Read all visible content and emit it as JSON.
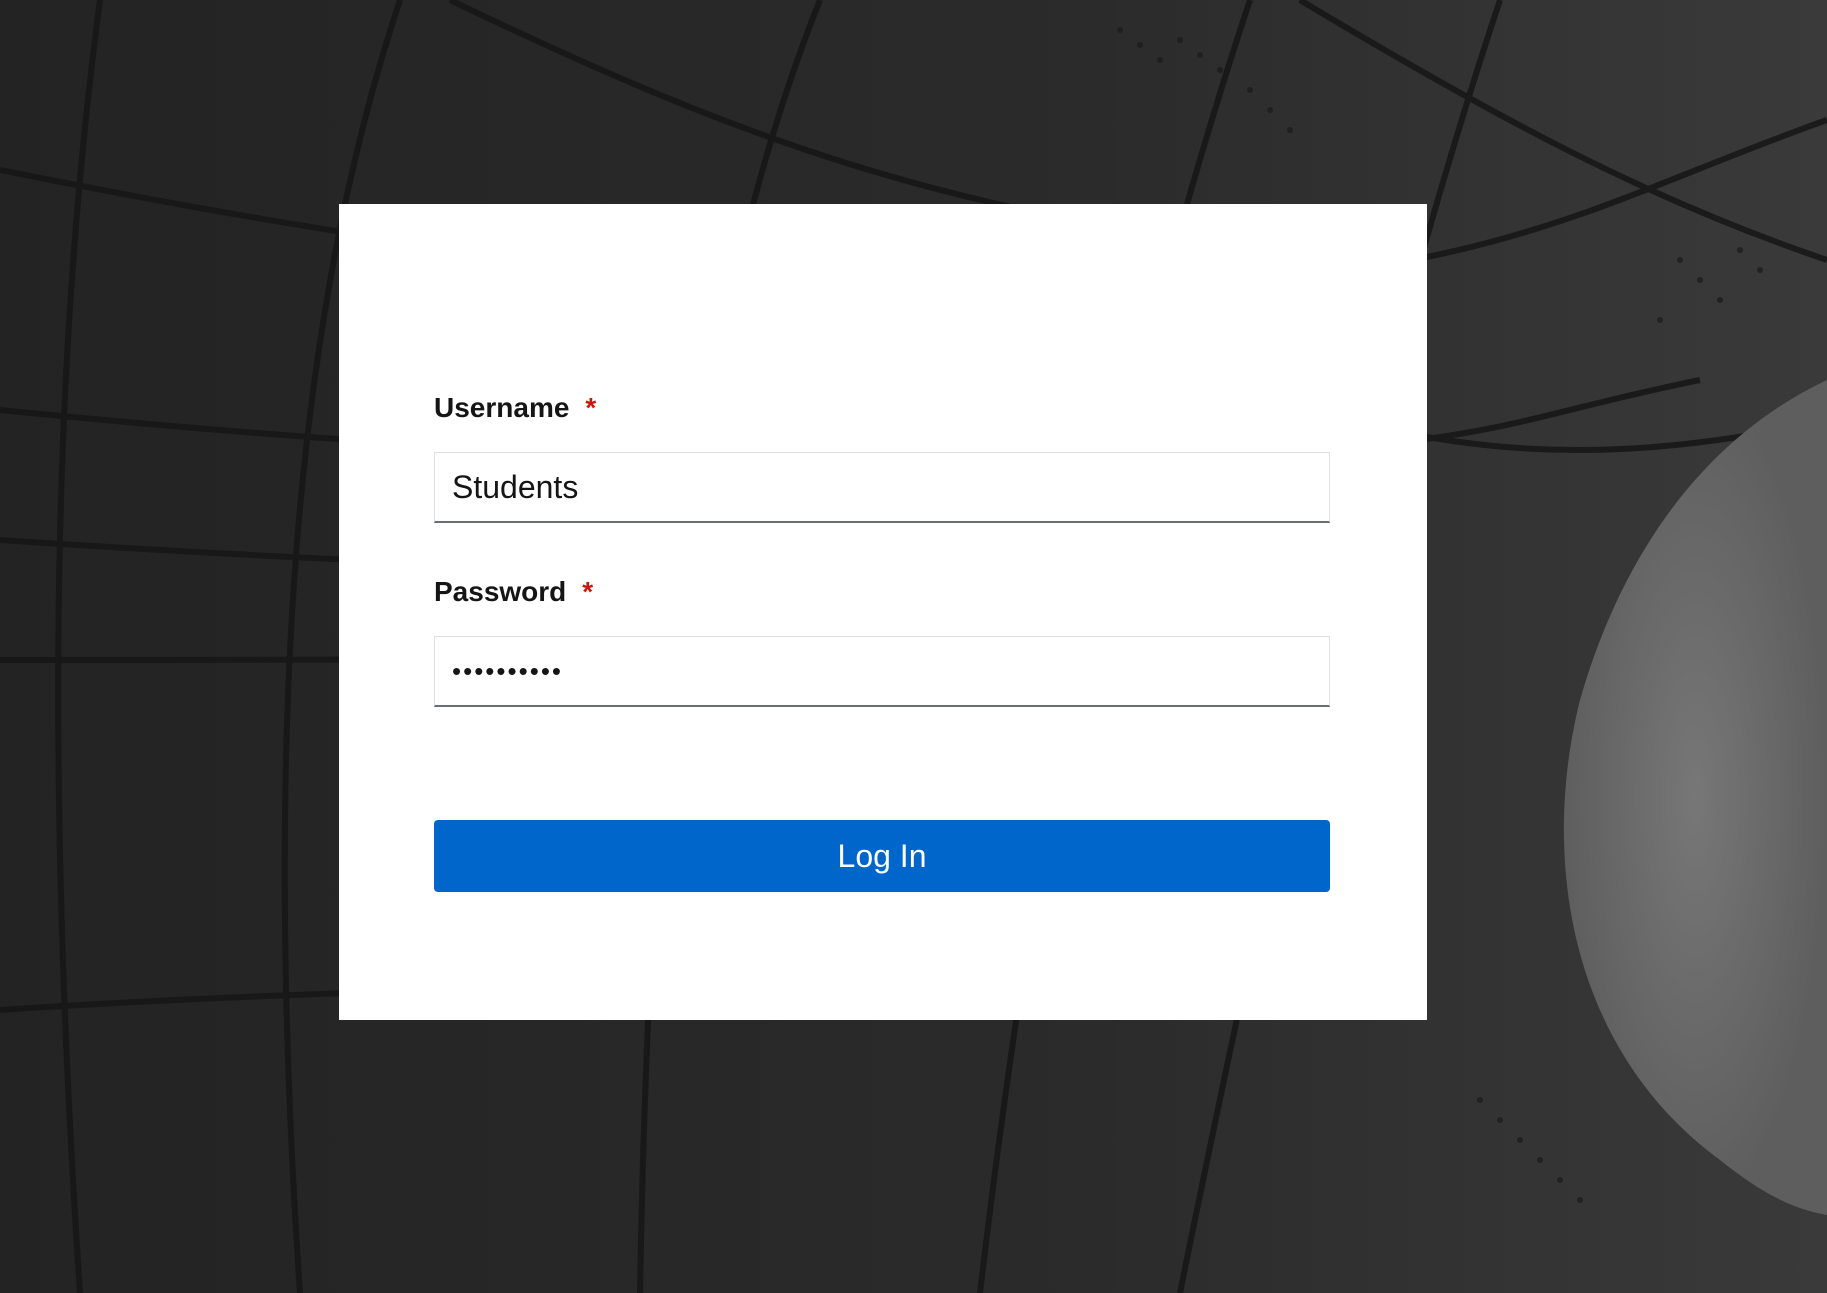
{
  "login_form": {
    "username": {
      "label": "Username",
      "required_marker": "*",
      "value": "Students"
    },
    "password": {
      "label": "Password",
      "required_marker": "*",
      "value": "••••••••••"
    },
    "submit_label": "Log In"
  },
  "colors": {
    "primary_button": "#0066cc",
    "required_marker": "#c9190b",
    "background": "#262626",
    "card": "#ffffff"
  }
}
